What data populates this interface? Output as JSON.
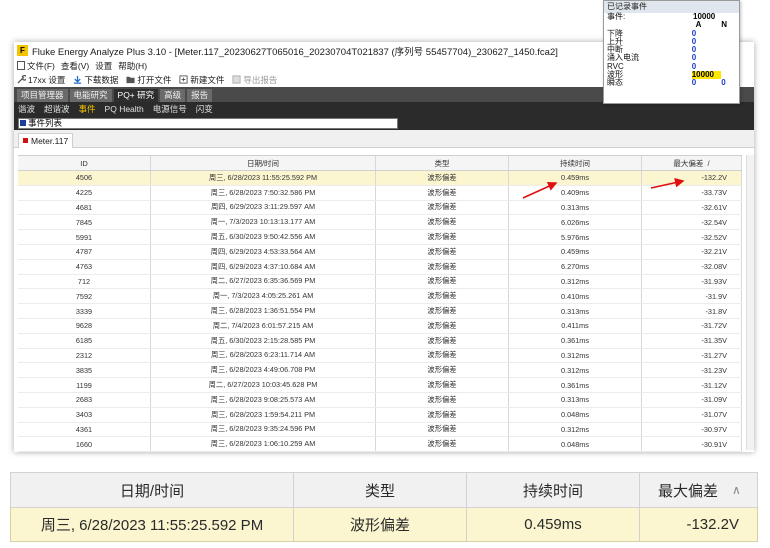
{
  "popup": {
    "title": "已记录事件",
    "header": {
      "label": "事件:",
      "total": "10000",
      "col_a": "A",
      "col_n": "N"
    },
    "rows": [
      {
        "label": "下降",
        "a": "0",
        "n": ""
      },
      {
        "label": "上升",
        "a": "0",
        "n": ""
      },
      {
        "label": "中断",
        "a": "0",
        "n": ""
      },
      {
        "label": "涌入电流",
        "a": "0",
        "n": ""
      },
      {
        "label": "RVC",
        "a": "0",
        "n": ""
      },
      {
        "label": "波形",
        "a": "10000",
        "n": ""
      },
      {
        "label": "瞬态",
        "a": "0",
        "n": "0"
      }
    ]
  },
  "app": {
    "title": "Fluke Energy Analyze Plus 3.10 - [Meter.117_20230627T065016_20230704T021837 (序列号 55457704)_230627_1450.fca2]",
    "menu": [
      "文件(F)",
      "查看(V)",
      "设置",
      "帮助(H)"
    ],
    "toolbar": {
      "setup": "17xx 设置",
      "download": "下载数据",
      "open": "打开文件",
      "new": "新建文件",
      "export": "导出报告"
    },
    "tabs": [
      "项目管理器",
      "电能研究",
      "PQ+ 研究",
      "高级",
      "报告"
    ],
    "active_tab": 2,
    "subtabs": [
      "谐波",
      "超谐波",
      "事件",
      "PQ Health",
      "电源信号",
      "闪变"
    ],
    "active_subtab": 2,
    "event_list_label": "事件列表",
    "meter_tab": "Meter.117"
  },
  "columns": {
    "id": "ID",
    "datetime": "日期/时间",
    "type": "类型",
    "duration": "持续时间",
    "max_dev": "最大偏差"
  },
  "rows": [
    {
      "id": "4506",
      "datetime": "周三, 6/28/2023 11:55:25.592 PM",
      "type": "波形偏差",
      "duration": "0.459ms",
      "max_dev": "-132.2V"
    },
    {
      "id": "4225",
      "datetime": "周三, 6/28/2023 7:50:32.586 PM",
      "type": "波形偏差",
      "duration": "0.409ms",
      "max_dev": "-33.73V"
    },
    {
      "id": "4681",
      "datetime": "周四, 6/29/2023 3:11:29.597 AM",
      "type": "波形偏差",
      "duration": "0.313ms",
      "max_dev": "-32.61V"
    },
    {
      "id": "7845",
      "datetime": "周一, 7/3/2023 10:13:13.177 AM",
      "type": "波形偏差",
      "duration": "6.026ms",
      "max_dev": "-32.54V"
    },
    {
      "id": "5991",
      "datetime": "周五, 6/30/2023 9:50:42.556 AM",
      "type": "波形偏差",
      "duration": "5.976ms",
      "max_dev": "-32.52V"
    },
    {
      "id": "4787",
      "datetime": "周四, 6/29/2023 4:53:33.564 AM",
      "type": "波形偏差",
      "duration": "0.459ms",
      "max_dev": "-32.21V"
    },
    {
      "id": "4763",
      "datetime": "周四, 6/29/2023 4:37:10.684 AM",
      "type": "波形偏差",
      "duration": "6.270ms",
      "max_dev": "-32.08V"
    },
    {
      "id": "712",
      "datetime": "周二, 6/27/2023 6:35:36.569 PM",
      "type": "波形偏差",
      "duration": "0.312ms",
      "max_dev": "-31.93V"
    },
    {
      "id": "7592",
      "datetime": "周一, 7/3/2023 4:05:25.261 AM",
      "type": "波形偏差",
      "duration": "0.410ms",
      "max_dev": "-31.9V"
    },
    {
      "id": "3339",
      "datetime": "周三, 6/28/2023 1:36:51.554 PM",
      "type": "波形偏差",
      "duration": "0.313ms",
      "max_dev": "-31.8V"
    },
    {
      "id": "9628",
      "datetime": "周二, 7/4/2023 6:01:57.215 AM",
      "type": "波形偏差",
      "duration": "0.411ms",
      "max_dev": "-31.72V"
    },
    {
      "id": "6185",
      "datetime": "周五, 6/30/2023 2:15:28.585 PM",
      "type": "波形偏差",
      "duration": "0.361ms",
      "max_dev": "-31.35V"
    },
    {
      "id": "2312",
      "datetime": "周三, 6/28/2023 6:23:11.714 AM",
      "type": "波形偏差",
      "duration": "0.312ms",
      "max_dev": "-31.27V"
    },
    {
      "id": "3835",
      "datetime": "周三, 6/28/2023 4:49:06.708 PM",
      "type": "波形偏差",
      "duration": "0.312ms",
      "max_dev": "-31.23V"
    },
    {
      "id": "1199",
      "datetime": "周二, 6/27/2023 10:03:45.628 PM",
      "type": "波形偏差",
      "duration": "0.361ms",
      "max_dev": "-31.12V"
    },
    {
      "id": "2683",
      "datetime": "周三, 6/28/2023 9:08:25.573 AM",
      "type": "波形偏差",
      "duration": "0.313ms",
      "max_dev": "-31.09V"
    },
    {
      "id": "3403",
      "datetime": "周三, 6/28/2023 1:59:54.211 PM",
      "type": "波形偏差",
      "duration": "0.048ms",
      "max_dev": "-31.07V"
    },
    {
      "id": "4361",
      "datetime": "周三, 6/28/2023 9:35:24.596 PM",
      "type": "波形偏差",
      "duration": "0.312ms",
      "max_dev": "-30.97V"
    },
    {
      "id": "1660",
      "datetime": "周三, 6/28/2023 1:06:10.259 AM",
      "type": "波形偏差",
      "duration": "0.048ms",
      "max_dev": "-30.91V"
    }
  ],
  "zoom": {
    "columns": {
      "datetime": "日期/时间",
      "type": "类型",
      "duration": "持续时间",
      "max_dev": "最大偏差",
      "sort_icon": "∧"
    },
    "row": {
      "datetime": "周三, 6/28/2023 11:55:25.592 PM",
      "type": "波形偏差",
      "duration": "0.459ms",
      "max_dev": "-132.2V"
    }
  },
  "colors": {
    "highlight_row": "#fbf6d0",
    "arrow": "#e01010",
    "popup_value": "#1a3ec8",
    "popup_highlight": "#ffe600",
    "active_subtab": "#f0c400"
  }
}
